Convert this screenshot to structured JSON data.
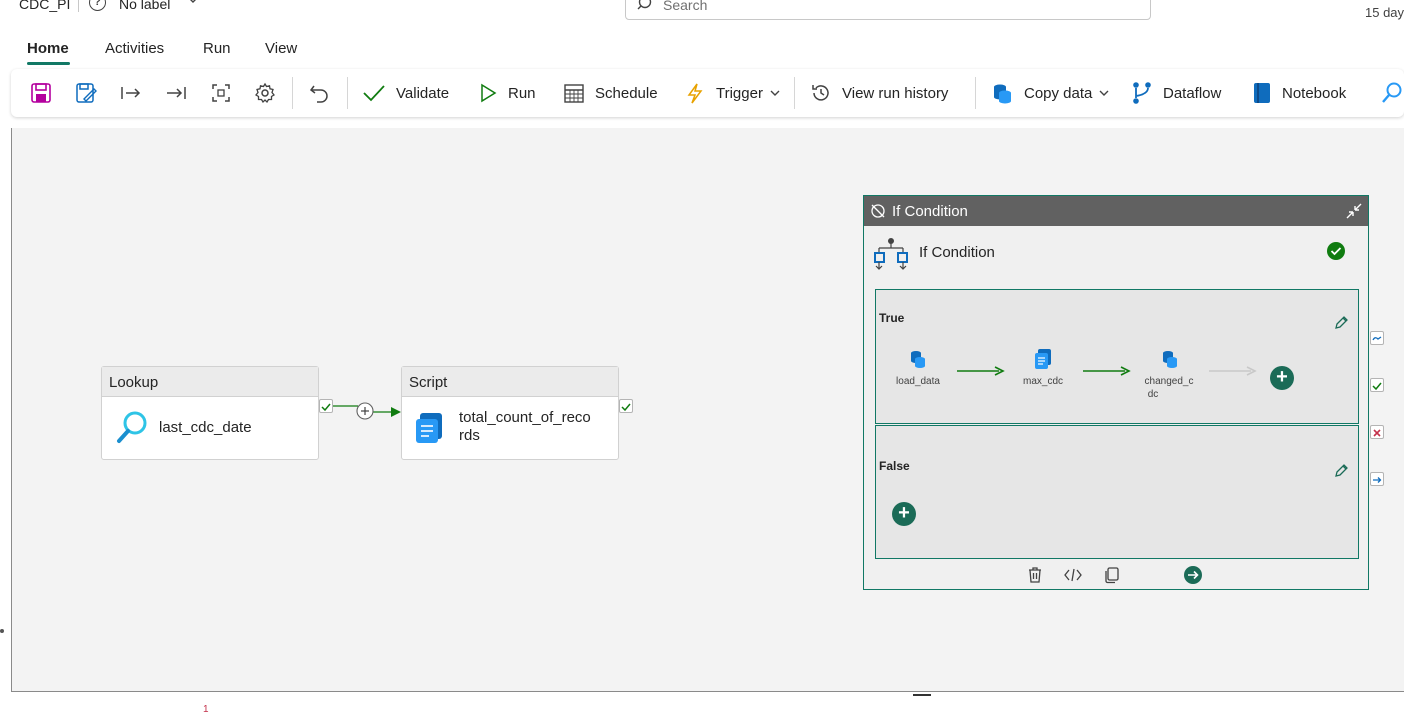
{
  "app": {
    "title": "CDC_PI",
    "sensitivity_label": "No label",
    "search_placeholder": "Search",
    "trial_text": "15 day"
  },
  "tabs": [
    {
      "label": "Home",
      "active": true
    },
    {
      "label": "Activities",
      "active": false
    },
    {
      "label": "Run",
      "active": false
    },
    {
      "label": "View",
      "active": false
    }
  ],
  "toolbar": {
    "validate": "Validate",
    "run": "Run",
    "schedule": "Schedule",
    "trigger": "Trigger",
    "view_run_history": "View run history",
    "copy_data": "Copy data",
    "dataflow": "Dataflow",
    "notebook": "Notebook"
  },
  "activities": {
    "lookup": {
      "type": "Lookup",
      "name": "last_cdc_date"
    },
    "script": {
      "type": "Script",
      "name_line1": "total_count_of_reco",
      "name_line2": "rds"
    }
  },
  "if_condition": {
    "header": "If Condition",
    "name": "If Condition",
    "true_branch": {
      "label": "True",
      "activities": [
        {
          "name": "load_data"
        },
        {
          "name": "max_cdc"
        },
        {
          "name_line1": "changed_c",
          "name_line2": "dc"
        }
      ]
    },
    "false_branch": {
      "label": "False"
    }
  },
  "bottom": {
    "badge": "1"
  },
  "colors": {
    "accent": "#117865",
    "success": "#107c10",
    "error": "#c4314b",
    "save_icon": "#b4009e",
    "copy_icon": "#0f6cbd"
  }
}
